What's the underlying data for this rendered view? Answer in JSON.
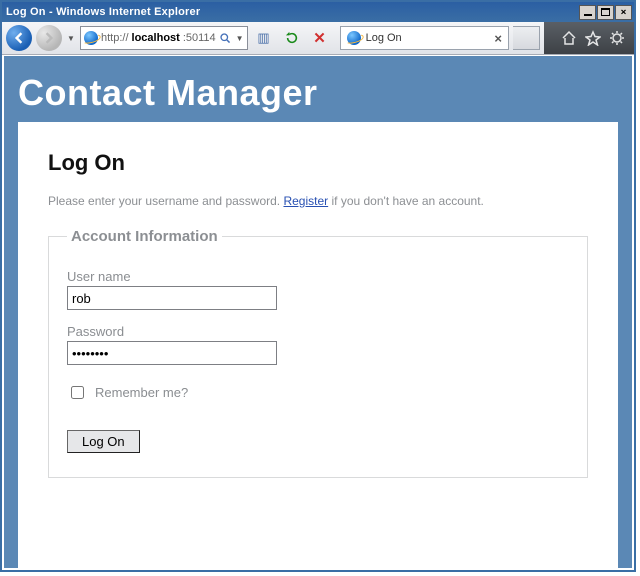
{
  "window": {
    "title": "Log On - Windows Internet Explorer"
  },
  "address": {
    "protocol": "http://",
    "host": "localhost",
    "rest": ":50114"
  },
  "tab": {
    "title": "Log On"
  },
  "page": {
    "brand": "Contact Manager",
    "heading": "Log On",
    "hint_prefix": "Please enter your username and password. ",
    "register_link": "Register",
    "hint_suffix": " if you don't have an account.",
    "fieldset_legend": "Account Information",
    "username_label": "User name",
    "username_value": "rob",
    "password_label": "Password",
    "password_value": "••••••••",
    "remember_label": "Remember me?",
    "submit_label": "Log On"
  }
}
